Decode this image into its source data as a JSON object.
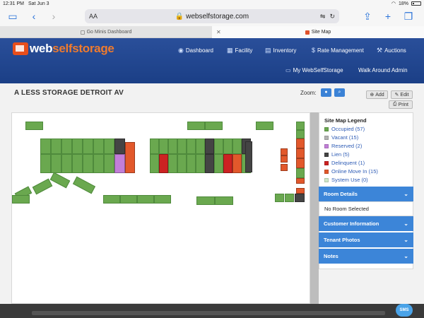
{
  "status": {
    "time": "12:31 PM",
    "date": "Sat Jun 3",
    "battery": "18%"
  },
  "browser": {
    "aa_label": "AA",
    "url": "webselfstorage.com",
    "tabs": [
      {
        "label": "Go Minis Dashboard",
        "active": false
      },
      {
        "label": "Site Map",
        "active": true
      }
    ]
  },
  "header": {
    "logo_web": "web",
    "logo_rest": "selfstorage",
    "nav": [
      {
        "label": "Dashboard",
        "icon": "dashboard-icon"
      },
      {
        "label": "Facility",
        "icon": "building-icon"
      },
      {
        "label": "Inventory",
        "icon": "inventory-icon"
      },
      {
        "label": "Rate Management",
        "icon": "dollar-icon"
      },
      {
        "label": "Auctions",
        "icon": "gavel-icon"
      }
    ],
    "my_site": "My WebSelfStorage",
    "user": "Walk Around Admin"
  },
  "page": {
    "facility_title": "A LESS STORAGE DETROIT AV",
    "zoom_label": "Zoom:",
    "add_label": "Add",
    "edit_label": "Edit",
    "print_label": "Print"
  },
  "legend": {
    "title": "Site Map Legend",
    "items": [
      {
        "label": "Occupied (57)",
        "color": "#6aa84f"
      },
      {
        "label": "Vacant (15)",
        "color": "#b3b3b3"
      },
      {
        "label": "Reserved (2)",
        "color": "#c27ed8"
      },
      {
        "label": "Lien (5)",
        "color": "#444444"
      },
      {
        "label": "Delinquent (1)",
        "color": "#cc2222"
      },
      {
        "label": "Online Move In (15)",
        "color": "#e2582b"
      },
      {
        "label": "System Use (0)",
        "color": "#cfe8c8"
      }
    ]
  },
  "panels": {
    "room_details": "Room Details",
    "room_details_body": "No Room Selected",
    "customer_info": "Customer Information",
    "tenant_photos": "Tenant Photos",
    "notes": "Notes"
  },
  "chat": {
    "label": "SMS"
  },
  "colors": {
    "occupied": "#6aa84f",
    "vacant": "#b3b3b3",
    "reserved": "#c27ed8",
    "lien": "#444444",
    "delinquent": "#cc2222",
    "online": "#e2582b",
    "header_blue": "#1f4589",
    "accordion_blue": "#3c85d8"
  }
}
